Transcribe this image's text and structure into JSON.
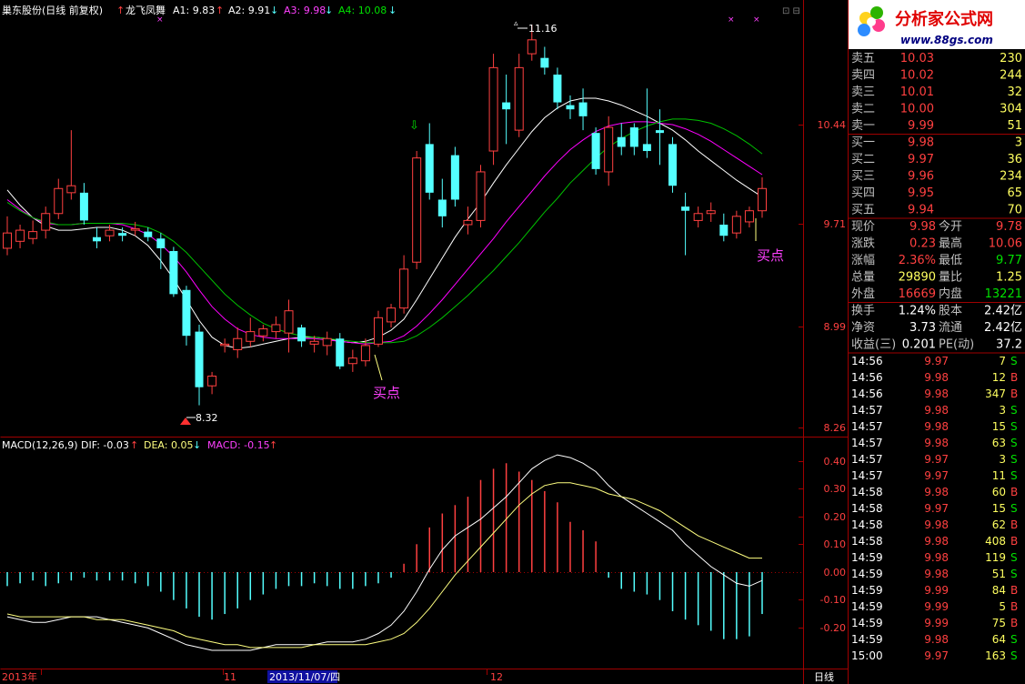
{
  "main_header": {
    "stock": "巢东股份(日线 前复权)",
    "indicator": "龙飞凤舞",
    "a1": "A1: 9.83",
    "a2": "A2: 9.91",
    "a3": "A3: 9.98",
    "a4": "A4: 10.08"
  },
  "macd_header": {
    "name": "MACD(12,26,9)",
    "dif": "DIF: -0.03",
    "dea": "DEA: 0.05",
    "macd": "MACD: -0.15"
  },
  "main_axis": {
    "ticks": [
      "10.44",
      "9.71",
      "8.99",
      "8.26"
    ]
  },
  "macd_axis": {
    "ticks": [
      "0.40",
      "0.30",
      "0.20",
      "0.10",
      "0.00",
      "-0.10",
      "-0.20"
    ]
  },
  "date_axis": {
    "labels": [
      "2013年",
      "11",
      "2013/11/07/四",
      "12"
    ],
    "period": "日线"
  },
  "annotations": {
    "high_label": "11.16",
    "low_label": "8.32",
    "buy_label_1": "买点",
    "buy_label_2": "买点"
  },
  "logo": {
    "title": "分析家公式网",
    "url": "www.88gs.com"
  },
  "colors": {
    "up": "#ff4040",
    "down": "#54ffff",
    "ma_white": "#ffffff",
    "ma_magenta": "#ff00ff",
    "ma_green": "#00c000",
    "dif_line": "#ffffff",
    "dea_line": "#ffff80",
    "grid": "#a00000",
    "label_magenta": "#ff40ff"
  },
  "order_book": {
    "asks": [
      {
        "label": "卖五",
        "price": "10.03",
        "vol": "230"
      },
      {
        "label": "卖四",
        "price": "10.02",
        "vol": "244"
      },
      {
        "label": "卖三",
        "price": "10.01",
        "vol": "32"
      },
      {
        "label": "卖二",
        "price": "10.00",
        "vol": "304"
      },
      {
        "label": "卖一",
        "price": "9.99",
        "vol": "51"
      }
    ],
    "bids": [
      {
        "label": "买一",
        "price": "9.98",
        "vol": "3"
      },
      {
        "label": "买二",
        "price": "9.97",
        "vol": "36"
      },
      {
        "label": "买三",
        "price": "9.96",
        "vol": "234"
      },
      {
        "label": "买四",
        "price": "9.95",
        "vol": "65"
      },
      {
        "label": "买五",
        "price": "9.94",
        "vol": "70"
      }
    ]
  },
  "quote": [
    {
      "l1": "现价",
      "v1": "9.98",
      "l2": "今开",
      "v2": "9.78"
    },
    {
      "l1": "涨跌",
      "v1": "0.23",
      "l2": "最高",
      "v2": "10.06"
    },
    {
      "l1": "涨幅",
      "v1": "2.36%",
      "l2": "最低",
      "v2": "9.77"
    },
    {
      "l1": "总量",
      "v1": "29890",
      "l2": "量比",
      "v2": "1.25"
    },
    {
      "l1": "外盘",
      "v1": "16669",
      "l2": "内盘",
      "v2": "13221"
    }
  ],
  "fundamentals": [
    {
      "l1": "换手",
      "v1": "1.24%",
      "l2": "股本",
      "v2": "2.42亿"
    },
    {
      "l1": "净资",
      "v1": "3.73",
      "l2": "流通",
      "v2": "2.42亿"
    },
    {
      "l1": "收益(三)",
      "v1": "0.201",
      "l2": "PE(动)",
      "v2": "37.2"
    }
  ],
  "ticks": [
    {
      "time": "14:56",
      "price": "9.97",
      "vol": "7",
      "side": "S"
    },
    {
      "time": "14:56",
      "price": "9.98",
      "vol": "12",
      "side": "B"
    },
    {
      "time": "14:56",
      "price": "9.98",
      "vol": "347",
      "side": "B"
    },
    {
      "time": "14:57",
      "price": "9.98",
      "vol": "3",
      "side": "S"
    },
    {
      "time": "14:57",
      "price": "9.98",
      "vol": "15",
      "side": "S"
    },
    {
      "time": "14:57",
      "price": "9.98",
      "vol": "63",
      "side": "S"
    },
    {
      "time": "14:57",
      "price": "9.97",
      "vol": "3",
      "side": "S"
    },
    {
      "time": "14:57",
      "price": "9.97",
      "vol": "11",
      "side": "S"
    },
    {
      "time": "14:58",
      "price": "9.98",
      "vol": "60",
      "side": "B"
    },
    {
      "time": "14:58",
      "price": "9.97",
      "vol": "15",
      "side": "S"
    },
    {
      "time": "14:58",
      "price": "9.98",
      "vol": "62",
      "side": "B"
    },
    {
      "time": "14:58",
      "price": "9.98",
      "vol": "408",
      "side": "B"
    },
    {
      "time": "14:59",
      "price": "9.98",
      "vol": "119",
      "side": "S"
    },
    {
      "time": "14:59",
      "price": "9.98",
      "vol": "51",
      "side": "S"
    },
    {
      "time": "14:59",
      "price": "9.99",
      "vol": "84",
      "side": "B"
    },
    {
      "time": "14:59",
      "price": "9.99",
      "vol": "5",
      "side": "B"
    },
    {
      "time": "14:59",
      "price": "9.99",
      "vol": "75",
      "side": "B"
    },
    {
      "time": "14:59",
      "price": "9.98",
      "vol": "64",
      "side": "S"
    },
    {
      "time": "15:00",
      "price": "9.97",
      "vol": "163",
      "side": "S"
    }
  ],
  "chart_data": [
    {
      "type": "candlestick",
      "title": "巢东股份(日线 前复权)",
      "ylim": [
        8.26,
        11.16
      ],
      "y_ticks": [
        10.44,
        9.71,
        8.99,
        8.26
      ],
      "x_labels": [
        "2013年",
        "11",
        "2013/11/07/四",
        "12"
      ],
      "annotations": [
        {
          "text": "11.16",
          "value": 11.16,
          "kind": "high"
        },
        {
          "text": "8.32",
          "value": 8.32,
          "kind": "low"
        },
        {
          "text": "买点",
          "kind": "buy-signal"
        },
        {
          "text": "买点",
          "kind": "buy-signal"
        }
      ],
      "candles": [
        {
          "o": 9.55,
          "h": 9.78,
          "l": 9.5,
          "c": 9.66
        },
        {
          "o": 9.6,
          "h": 9.72,
          "l": 9.55,
          "c": 9.68
        },
        {
          "o": 9.62,
          "h": 9.75,
          "l": 9.58,
          "c": 9.67
        },
        {
          "o": 9.68,
          "h": 9.85,
          "l": 9.62,
          "c": 9.8
        },
        {
          "o": 9.8,
          "h": 10.05,
          "l": 9.76,
          "c": 9.98
        },
        {
          "o": 9.95,
          "h": 10.4,
          "l": 9.9,
          "c": 10.0
        },
        {
          "o": 9.95,
          "h": 10.02,
          "l": 9.72,
          "c": 9.75
        },
        {
          "o": 9.63,
          "h": 9.7,
          "l": 9.55,
          "c": 9.6
        },
        {
          "o": 9.64,
          "h": 9.72,
          "l": 9.6,
          "c": 9.68
        },
        {
          "o": 9.66,
          "h": 9.7,
          "l": 9.6,
          "c": 9.64
        },
        {
          "o": 9.68,
          "h": 9.74,
          "l": 9.64,
          "c": 9.69
        },
        {
          "o": 9.67,
          "h": 9.7,
          "l": 9.6,
          "c": 9.63
        },
        {
          "o": 9.62,
          "h": 9.66,
          "l": 9.4,
          "c": 9.55
        },
        {
          "o": 9.53,
          "h": 9.56,
          "l": 9.2,
          "c": 9.22
        },
        {
          "o": 9.25,
          "h": 9.28,
          "l": 8.85,
          "c": 8.92
        },
        {
          "o": 8.95,
          "h": 9.0,
          "l": 8.42,
          "c": 8.55
        },
        {
          "o": 8.56,
          "h": 8.66,
          "l": 8.5,
          "c": 8.63
        },
        {
          "o": 8.85,
          "h": 8.9,
          "l": 8.8,
          "c": 8.86
        },
        {
          "o": 8.82,
          "h": 8.98,
          "l": 8.76,
          "c": 8.9
        },
        {
          "o": 8.88,
          "h": 9.05,
          "l": 8.84,
          "c": 8.95
        },
        {
          "o": 8.92,
          "h": 9.0,
          "l": 8.88,
          "c": 8.97
        },
        {
          "o": 8.95,
          "h": 9.06,
          "l": 8.9,
          "c": 9.0
        },
        {
          "o": 8.94,
          "h": 9.18,
          "l": 8.8,
          "c": 9.1
        },
        {
          "o": 8.98,
          "h": 9.0,
          "l": 8.84,
          "c": 8.88
        },
        {
          "o": 8.86,
          "h": 8.92,
          "l": 8.8,
          "c": 8.88
        },
        {
          "o": 8.85,
          "h": 8.95,
          "l": 8.78,
          "c": 8.9
        },
        {
          "o": 8.9,
          "h": 8.94,
          "l": 8.68,
          "c": 8.7
        },
        {
          "o": 8.72,
          "h": 8.82,
          "l": 8.66,
          "c": 8.76
        },
        {
          "o": 8.74,
          "h": 8.9,
          "l": 8.7,
          "c": 8.85
        },
        {
          "o": 8.86,
          "h": 9.1,
          "l": 8.84,
          "c": 9.05
        },
        {
          "o": 9.02,
          "h": 9.15,
          "l": 8.98,
          "c": 9.12
        },
        {
          "o": 9.12,
          "h": 9.5,
          "l": 9.08,
          "c": 9.4
        },
        {
          "o": 9.45,
          "h": 10.25,
          "l": 9.4,
          "c": 10.2
        },
        {
          "o": 10.3,
          "h": 10.45,
          "l": 9.9,
          "c": 9.95
        },
        {
          "o": 9.9,
          "h": 10.05,
          "l": 9.7,
          "c": 9.78
        },
        {
          "o": 10.22,
          "h": 10.28,
          "l": 9.85,
          "c": 9.9
        },
        {
          "o": 9.72,
          "h": 9.85,
          "l": 9.65,
          "c": 9.75
        },
        {
          "o": 9.75,
          "h": 10.15,
          "l": 9.7,
          "c": 10.1
        },
        {
          "o": 10.25,
          "h": 10.95,
          "l": 10.15,
          "c": 10.85
        },
        {
          "o": 10.6,
          "h": 10.8,
          "l": 10.3,
          "c": 10.55
        },
        {
          "o": 10.4,
          "h": 10.95,
          "l": 10.35,
          "c": 10.85
        },
        {
          "o": 10.95,
          "h": 11.16,
          "l": 10.9,
          "c": 11.05
        },
        {
          "o": 10.92,
          "h": 11.0,
          "l": 10.8,
          "c": 10.85
        },
        {
          "o": 10.8,
          "h": 10.85,
          "l": 10.55,
          "c": 10.6
        },
        {
          "o": 10.58,
          "h": 10.65,
          "l": 10.48,
          "c": 10.55
        },
        {
          "o": 10.6,
          "h": 10.7,
          "l": 10.4,
          "c": 10.5
        },
        {
          "o": 10.38,
          "h": 10.42,
          "l": 10.08,
          "c": 10.12
        },
        {
          "o": 10.1,
          "h": 10.5,
          "l": 10.0,
          "c": 10.42
        },
        {
          "o": 10.35,
          "h": 10.45,
          "l": 10.22,
          "c": 10.28
        },
        {
          "o": 10.42,
          "h": 10.45,
          "l": 10.22,
          "c": 10.28
        },
        {
          "o": 10.3,
          "h": 10.7,
          "l": 10.2,
          "c": 10.25
        },
        {
          "o": 10.4,
          "h": 10.55,
          "l": 10.15,
          "c": 10.38
        },
        {
          "o": 10.3,
          "h": 10.35,
          "l": 9.95,
          "c": 10.0
        },
        {
          "o": 9.85,
          "h": 9.95,
          "l": 9.5,
          "c": 9.82
        },
        {
          "o": 9.75,
          "h": 9.85,
          "l": 9.7,
          "c": 9.8
        },
        {
          "o": 9.8,
          "h": 9.88,
          "l": 9.74,
          "c": 9.82
        },
        {
          "o": 9.72,
          "h": 9.8,
          "l": 9.6,
          "c": 9.64
        },
        {
          "o": 9.66,
          "h": 9.82,
          "l": 9.62,
          "c": 9.78
        },
        {
          "o": 9.74,
          "h": 9.85,
          "l": 9.7,
          "c": 9.82
        },
        {
          "o": 9.82,
          "h": 10.06,
          "l": 9.77,
          "c": 9.98
        }
      ],
      "lines": [
        {
          "values": [
            9.97,
            9.86,
            9.77,
            9.71,
            9.68,
            9.68,
            9.69,
            9.7,
            9.7,
            9.68,
            9.64,
            9.57,
            9.46,
            9.33,
            9.18,
            9.03,
            8.91,
            8.85,
            8.83,
            8.84,
            8.86,
            8.88,
            8.9,
            8.91,
            8.91,
            8.9,
            8.88,
            8.87,
            8.88,
            8.91,
            8.96,
            9.04,
            9.18,
            9.33,
            9.48,
            9.63,
            9.76,
            9.88,
            10.02,
            10.15,
            10.27,
            10.39,
            10.49,
            10.56,
            10.61,
            10.63,
            10.63,
            10.61,
            10.58,
            10.54,
            10.5,
            10.45,
            10.4,
            10.33,
            10.25,
            10.18,
            10.11,
            10.04,
            9.98,
            9.92
          ]
        },
        {
          "values": [
            9.9,
            9.83,
            9.77,
            9.73,
            9.72,
            9.72,
            9.73,
            9.73,
            9.73,
            9.72,
            9.69,
            9.65,
            9.58,
            9.49,
            9.38,
            9.25,
            9.13,
            9.04,
            8.97,
            8.93,
            8.91,
            8.9,
            8.9,
            8.9,
            8.9,
            8.89,
            8.88,
            8.87,
            8.86,
            8.87,
            8.88,
            8.92,
            8.99,
            9.08,
            9.18,
            9.29,
            9.4,
            9.51,
            9.62,
            9.74,
            9.85,
            9.96,
            10.07,
            10.17,
            10.26,
            10.33,
            10.39,
            10.43,
            10.45,
            10.46,
            10.46,
            10.45,
            10.44,
            10.41,
            10.37,
            10.32,
            10.26,
            10.2,
            10.14,
            10.08
          ]
        },
        {
          "values": [
            9.88,
            9.82,
            9.77,
            9.74,
            9.72,
            9.72,
            9.73,
            9.73,
            9.73,
            9.73,
            9.72,
            9.7,
            9.66,
            9.6,
            9.52,
            9.42,
            9.32,
            9.22,
            9.14,
            9.07,
            9.01,
            8.97,
            8.94,
            8.92,
            8.91,
            8.9,
            8.89,
            8.88,
            8.87,
            8.87,
            8.87,
            8.88,
            8.92,
            8.98,
            9.05,
            9.13,
            9.21,
            9.3,
            9.39,
            9.49,
            9.59,
            9.7,
            9.81,
            9.91,
            10.02,
            10.11,
            10.2,
            10.28,
            10.34,
            10.39,
            10.43,
            10.46,
            10.48,
            10.48,
            10.47,
            10.45,
            10.41,
            10.36,
            10.3,
            10.23
          ]
        }
      ]
    },
    {
      "type": "bar",
      "title": "MACD(12,26,9)",
      "ylim": [
        -0.25,
        0.45
      ],
      "y_ticks": [
        0.4,
        0.3,
        0.2,
        0.1,
        0.0,
        -0.1,
        -0.2
      ],
      "series": [
        {
          "name": "MACD",
          "values": [
            -0.05,
            -0.04,
            -0.03,
            -0.05,
            -0.04,
            -0.03,
            -0.02,
            -0.03,
            -0.03,
            -0.03,
            -0.04,
            -0.05,
            -0.07,
            -0.1,
            -0.13,
            -0.16,
            -0.17,
            -0.15,
            -0.13,
            -0.1,
            -0.08,
            -0.06,
            -0.05,
            -0.05,
            -0.04,
            -0.05,
            -0.06,
            -0.06,
            -0.05,
            -0.04,
            -0.02,
            0.03,
            0.1,
            0.16,
            0.21,
            0.24,
            0.27,
            0.33,
            0.37,
            0.39,
            0.36,
            0.33,
            0.29,
            0.25,
            0.18,
            0.15,
            0.11,
            -0.02,
            -0.06,
            -0.07,
            -0.08,
            -0.1,
            -0.14,
            -0.17,
            -0.19,
            -0.21,
            -0.24,
            -0.24,
            -0.23,
            -0.15
          ]
        },
        {
          "name": "DIF",
          "values": [
            -0.16,
            -0.17,
            -0.18,
            -0.18,
            -0.17,
            -0.16,
            -0.16,
            -0.16,
            -0.17,
            -0.18,
            -0.19,
            -0.2,
            -0.22,
            -0.24,
            -0.26,
            -0.27,
            -0.28,
            -0.28,
            -0.28,
            -0.28,
            -0.27,
            -0.26,
            -0.26,
            -0.26,
            -0.26,
            -0.25,
            -0.25,
            -0.25,
            -0.24,
            -0.22,
            -0.19,
            -0.14,
            -0.07,
            0.01,
            0.08,
            0.13,
            0.16,
            0.19,
            0.23,
            0.27,
            0.32,
            0.37,
            0.4,
            0.42,
            0.41,
            0.39,
            0.36,
            0.31,
            0.27,
            0.24,
            0.21,
            0.18,
            0.15,
            0.1,
            0.06,
            0.02,
            -0.01,
            -0.04,
            -0.05,
            -0.03
          ]
        },
        {
          "name": "DEA",
          "values": [
            -0.15,
            -0.16,
            -0.16,
            -0.16,
            -0.16,
            -0.16,
            -0.16,
            -0.17,
            -0.17,
            -0.17,
            -0.18,
            -0.19,
            -0.2,
            -0.21,
            -0.23,
            -0.24,
            -0.25,
            -0.26,
            -0.26,
            -0.27,
            -0.27,
            -0.27,
            -0.27,
            -0.27,
            -0.26,
            -0.26,
            -0.26,
            -0.26,
            -0.26,
            -0.25,
            -0.24,
            -0.22,
            -0.18,
            -0.13,
            -0.07,
            -0.01,
            0.04,
            0.09,
            0.14,
            0.19,
            0.24,
            0.28,
            0.31,
            0.32,
            0.32,
            0.31,
            0.3,
            0.28,
            0.27,
            0.26,
            0.24,
            0.22,
            0.19,
            0.16,
            0.13,
            0.11,
            0.09,
            0.07,
            0.05,
            0.05
          ]
        }
      ]
    }
  ]
}
